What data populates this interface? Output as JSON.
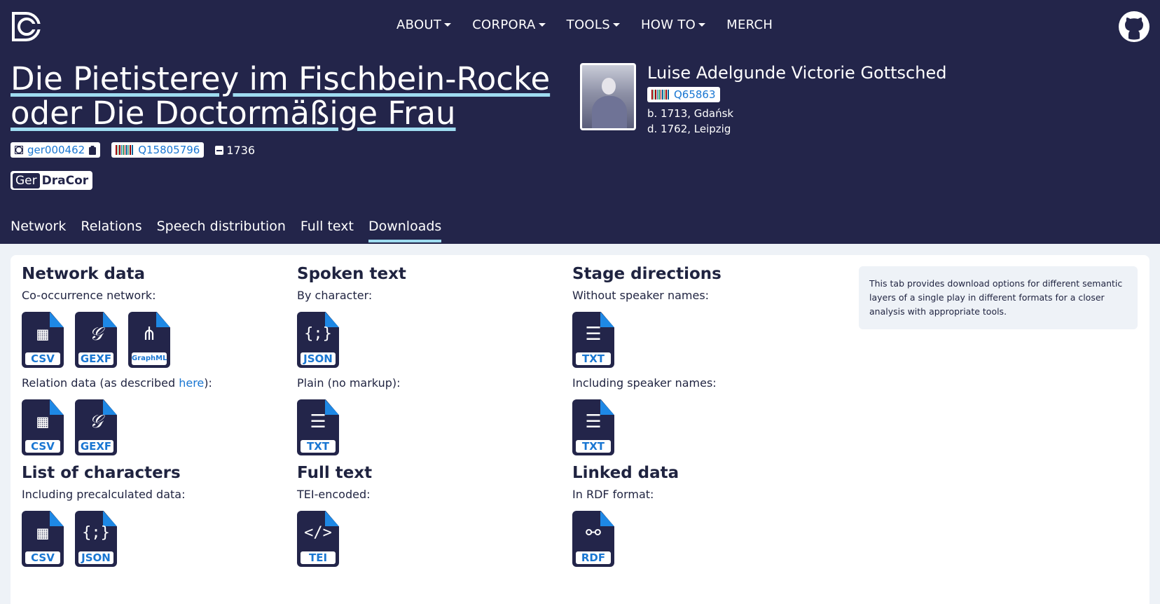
{
  "nav": {
    "items": [
      {
        "label": "ABOUT",
        "dropdown": true
      },
      {
        "label": "CORPORA",
        "dropdown": true
      },
      {
        "label": "TOOLS",
        "dropdown": true
      },
      {
        "label": "HOW TO",
        "dropdown": true
      },
      {
        "label": "MERCH",
        "dropdown": false
      }
    ]
  },
  "play": {
    "title_line1": "Die Pietisterey im Fischbein-Rocke",
    "title_line2": "oder Die Doctormäßige Frau",
    "id": "ger000462",
    "wikidata": "Q15805796",
    "year": "1736",
    "corpus_prefix": "Ger",
    "corpus_name": "DraCor"
  },
  "author": {
    "name": "Luise Adelgunde Victorie Gottsched",
    "wikidata": "Q65863",
    "born": "b. 1713, Gdańsk",
    "died": "d. 1762, Leipzig"
  },
  "tabs": [
    "Network",
    "Relations",
    "Speech distribution",
    "Full text",
    "Downloads"
  ],
  "active_tab": "Downloads",
  "downloads": {
    "network": {
      "heading": "Network data",
      "cooccurrence_label": "Co-occurrence network:",
      "relation_label_before": "Relation data (as described ",
      "relation_link": "here",
      "relation_label_after": "):"
    },
    "spoken": {
      "heading": "Spoken text",
      "by_character_label": "By character:",
      "plain_label": "Plain (no markup):"
    },
    "stage": {
      "heading": "Stage directions",
      "without_label": "Without speaker names:",
      "with_label": "Including speaker names:"
    },
    "characters": {
      "heading": "List of characters",
      "label": "Including precalculated data:"
    },
    "fulltext": {
      "heading": "Full text",
      "label": "TEI-encoded:"
    },
    "linked": {
      "heading": "Linked data",
      "label": "In RDF format:"
    },
    "formats": {
      "csv": "CSV",
      "gexf": "GEXF",
      "graphml": "GraphML",
      "json": "JSON",
      "txt": "TXT",
      "tei": "TEI",
      "rdf": "RDF"
    }
  },
  "info_text": "This tab provides download options for different semantic layers of a single play in different formats for a closer analysis with appropriate tools.",
  "colors": {
    "header_bg": "#23254a",
    "accent": "#1976d2",
    "underline": "#9fdcf0",
    "fold": "#1e88e5"
  }
}
